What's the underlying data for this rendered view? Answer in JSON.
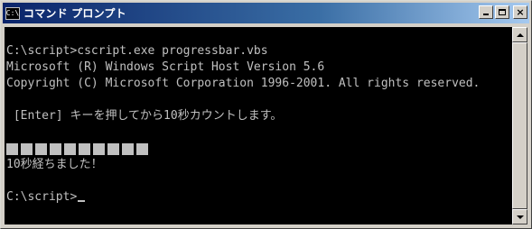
{
  "window": {
    "title": "コマンド プロンプト",
    "icon_name": "command-prompt-icon",
    "icon_text": "C:\\",
    "buttons": {
      "minimize": "minimize-icon",
      "maximize": "maximize-icon",
      "close": "×"
    }
  },
  "console": {
    "lines": [
      "C:\\script>cscript.exe progressbar.vbs",
      "Microsoft (R) Windows Script Host Version 5.6",
      "Copyright (C) Microsoft Corporation 1996-2001. All rights reserved.",
      "",
      " [Enter] キーを押してから10秒カウントします。",
      ""
    ],
    "progress_blocks": 10,
    "after_lines": [
      "10秒経ちました！",
      "",
      "C:\\script>"
    ]
  },
  "colors": {
    "console_bg": "#000000",
    "console_fg": "#C0C0C0",
    "title_gradient_start": "#0A246A",
    "title_gradient_end": "#A6CAF0"
  }
}
